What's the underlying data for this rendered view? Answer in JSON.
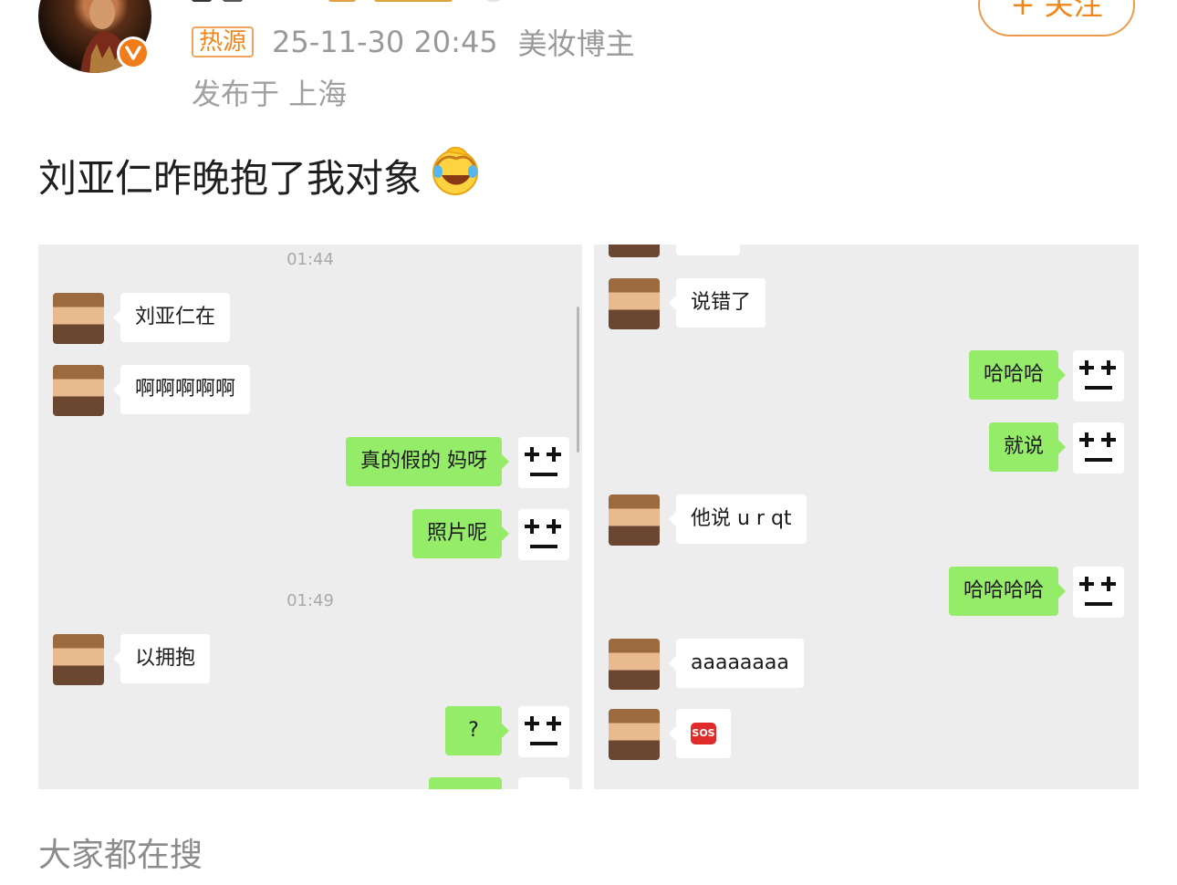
{
  "post": {
    "hot_tag": "热源",
    "datetime": "25-11-30 20:45",
    "role": "美妆博主",
    "location": "发布于 上海",
    "follow_label": "+ 关注",
    "text": "刘亚仁昨晚抱了我对象"
  },
  "chat_left": {
    "timestamp_1": "01:44",
    "timestamp_2": "01:49",
    "msg_1": "刘亚仁在",
    "msg_2": "啊啊啊啊啊",
    "msg_3": "真的假的 妈呀",
    "msg_4": "照片呢",
    "msg_5": "以拥抱",
    "msg_6": "?"
  },
  "chat_right": {
    "msg_1": "说错了",
    "msg_2": "哈哈哈",
    "msg_3": "就说",
    "msg_4": "他说 u r qt",
    "msg_5": "哈哈哈哈",
    "msg_6": "aaaaaaaa",
    "sos_text": "SOS"
  },
  "footer": {
    "search_label": "大家都在搜"
  },
  "colors": {
    "accent_orange": "#f0871a",
    "sent_bubble": "#95ec69",
    "chat_bg": "#ededed"
  },
  "icons": {
    "verified": "verified-badge-icon",
    "laugh": "laughing-emoji-icon",
    "sos": "sos-icon"
  }
}
